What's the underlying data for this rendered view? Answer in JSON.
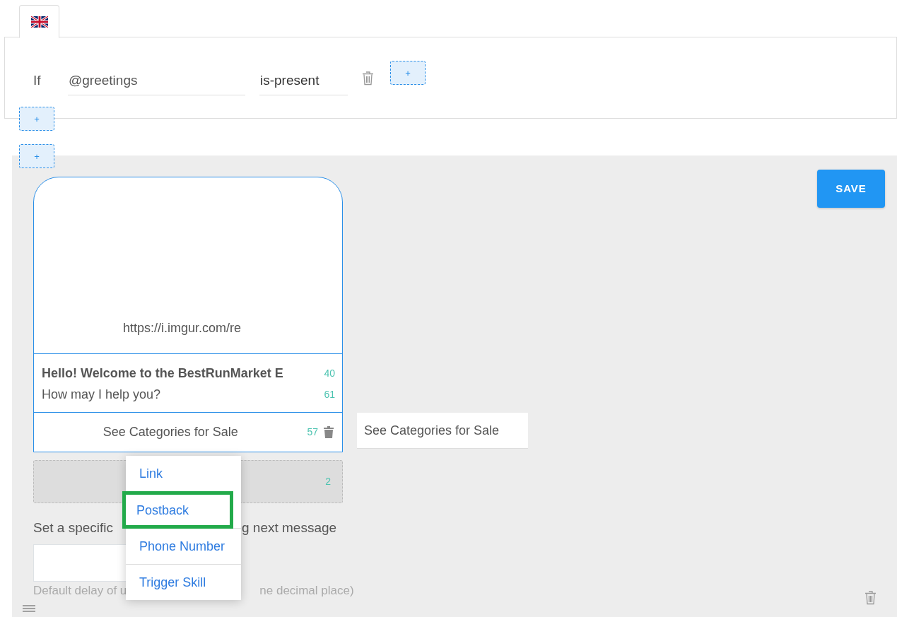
{
  "language_tabs": [
    {
      "selected": true
    }
  ],
  "condition": {
    "keyword": "If",
    "variable": "@greetings",
    "operator": "is-present"
  },
  "add_buttons": [
    "+",
    "+",
    "+"
  ],
  "save_button": "SAVE",
  "card": {
    "image_url": "https://i.imgur.com/re",
    "title": "Hello! Welcome to the BestRunMarket E",
    "title_count": "40",
    "subtitle": "How may I help you?",
    "subtitle_count": "61",
    "buttons": [
      {
        "label": "See Categories for Sale",
        "count": "57",
        "value": "See Categories for Sale"
      }
    ],
    "new_button_count": "2"
  },
  "button_type_menu": [
    {
      "label": "Link",
      "selected": false
    },
    {
      "label": "Postback",
      "selected": true
    },
    {
      "label": "Phone Number",
      "selected": false
    },
    {
      "label": "Trigger Skill",
      "selected": false
    }
  ],
  "delay": {
    "label_parts": [
      "Set a specific",
      "g next message"
    ],
    "hint_parts": [
      "Default delay of u",
      "ne decimal place)"
    ]
  }
}
